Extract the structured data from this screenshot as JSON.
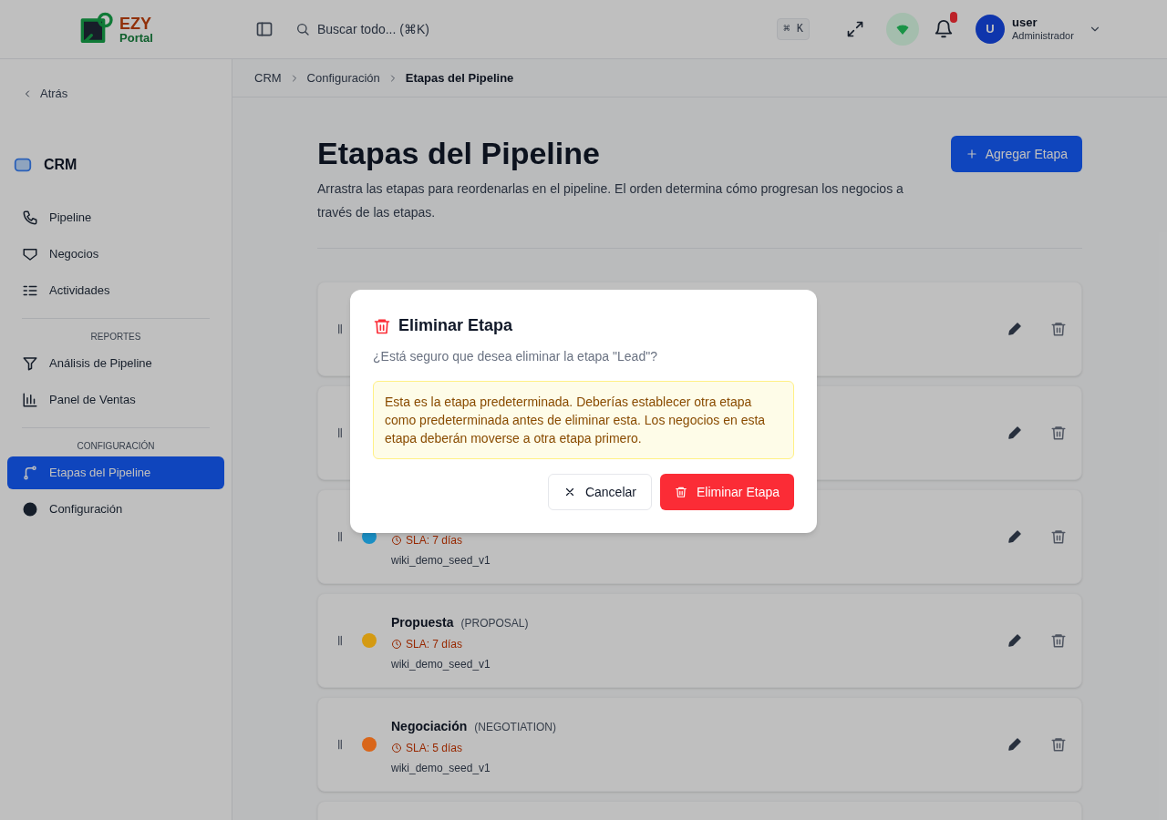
{
  "header": {
    "logo": {
      "line_1": "EZY",
      "line_2": "Portal"
    },
    "search": {
      "placeholder": "Buscar todo... (⌘K)",
      "shortcut": "⌘ K"
    },
    "user": {
      "initial": "U",
      "name": "user",
      "role": "Administrador"
    }
  },
  "breadcrumb": [
    "CRM",
    "Configuración",
    "Etapas del Pipeline"
  ],
  "sidebar": {
    "back": "Atrás",
    "module": "CRM",
    "sections": [
      {
        "items": [
          {
            "label": "Pipeline",
            "selected": false
          },
          {
            "label": "Negocios",
            "selected": false
          },
          {
            "label": "Actividades",
            "selected": false
          }
        ]
      },
      {
        "heading": "REPORTES",
        "items": [
          {
            "label": "Análisis de Pipeline",
            "selected": false
          },
          {
            "label": "Panel de Ventas",
            "selected": false
          }
        ]
      },
      {
        "heading": "CONFIGURACIÓN",
        "items": [
          {
            "label": "Etapas del Pipeline",
            "selected": true
          },
          {
            "label": "Configuración",
            "selected": false
          }
        ]
      }
    ]
  },
  "page": {
    "title": "Etapas del Pipeline",
    "description": "Arrastra las etapas para reordenarlas en el pipeline. El orden determina cómo progresan los negocios a través de las etapas.",
    "add_button": "Agregar Etapa"
  },
  "stages": [
    {
      "kind": "row"
    },
    {
      "kind": "row"
    },
    {
      "kind": "row",
      "color": "#1b8fc4",
      "sla": "SLA: 7 días",
      "tag": "wiki_demo_seed_v1"
    },
    {
      "kind": "row",
      "name": "Propuesta",
      "code": "(PROPOSAL)",
      "color": "#d49a12",
      "sla": "SLA: 7 días",
      "tag": "wiki_demo_seed_v1"
    },
    {
      "kind": "row",
      "name": "Negociación",
      "code": "(NEGOTIATION)",
      "color": "#d9661a",
      "sla": "SLA: 5 días",
      "tag": "wiki_demo_seed_v1"
    },
    {
      "kind": "cut"
    }
  ],
  "dialog": {
    "title": "Eliminar Etapa",
    "question": "¿Está seguro que desea eliminar la etapa \"Lead\"?",
    "warning": "Esta es la etapa predeterminada. Deberías establecer otra etapa como predeterminada antes de eliminar esta. Los negocios en esta etapa deberán moverse a otra etapa primero.",
    "buttons": [
      {
        "kind": "cancel",
        "label": "Cancelar"
      },
      {
        "kind": "danger",
        "label": "Eliminar Etapa"
      }
    ]
  }
}
